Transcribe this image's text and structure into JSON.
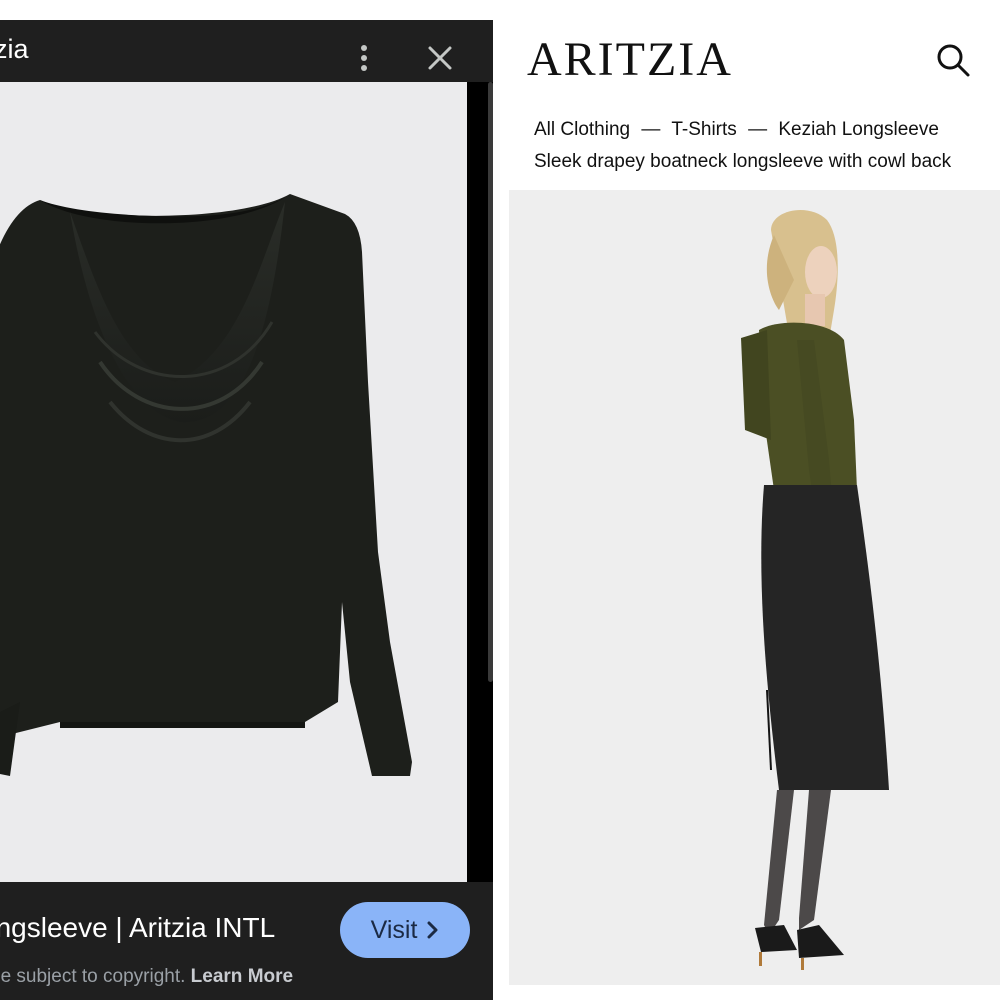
{
  "viewer": {
    "title": "zia",
    "caption": "ongsleeve | Aritzia INTL",
    "visit_label": "Visit",
    "copyright_text": "be subject to copyright.",
    "learn_more_label": "Learn More",
    "icons": [
      "more-vert-icon",
      "close-icon",
      "chevron-right-icon"
    ]
  },
  "store": {
    "brand": "ARITZIA",
    "breadcrumb": [
      "All Clothing",
      "T-Shirts",
      "Keziah Longsleeve"
    ],
    "breadcrumb_separator": "—",
    "description": "Sleek drapey boatneck longsleeve with cowl back",
    "icons": [
      "search-icon"
    ]
  },
  "colors": {
    "viewer_bar": "#1f1f1f",
    "visit_button": "#8ab4f8",
    "garment": "#1d1f1b",
    "model_top": "#4b4f24"
  }
}
